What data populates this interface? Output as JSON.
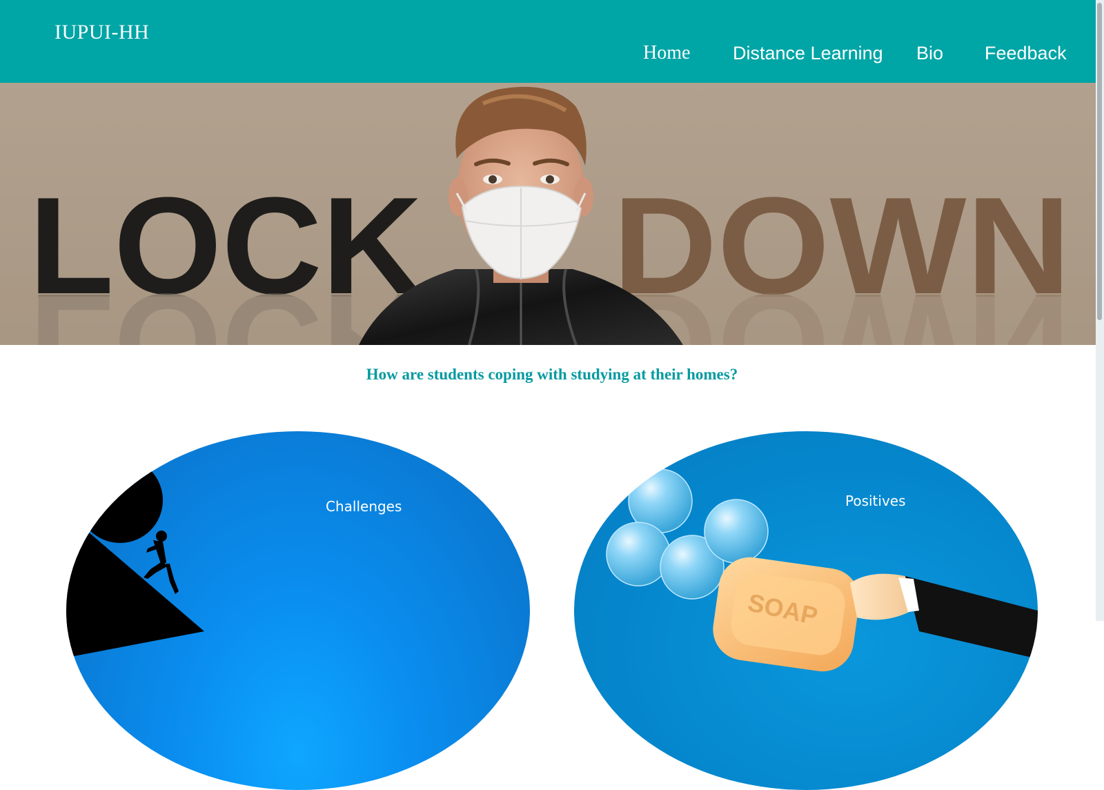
{
  "site": {
    "brand": "IUPUI-HH",
    "nav": {
      "home": "Home",
      "distance_learning": "Distance Learning",
      "bio": "Bio",
      "feedback": "Feedback"
    },
    "accent_color": "#00a5a6"
  },
  "hero": {
    "word_left": "LOCK",
    "word_right": "DOWN"
  },
  "intro": {
    "question": "How are students coping with studying at their homes?"
  },
  "cards": [
    {
      "label": "Challenges",
      "icon": "boulder-pusher-silhouette"
    },
    {
      "label": "Positives",
      "icon": "soap-and-bubbles"
    }
  ],
  "soap_text": "SOAP"
}
